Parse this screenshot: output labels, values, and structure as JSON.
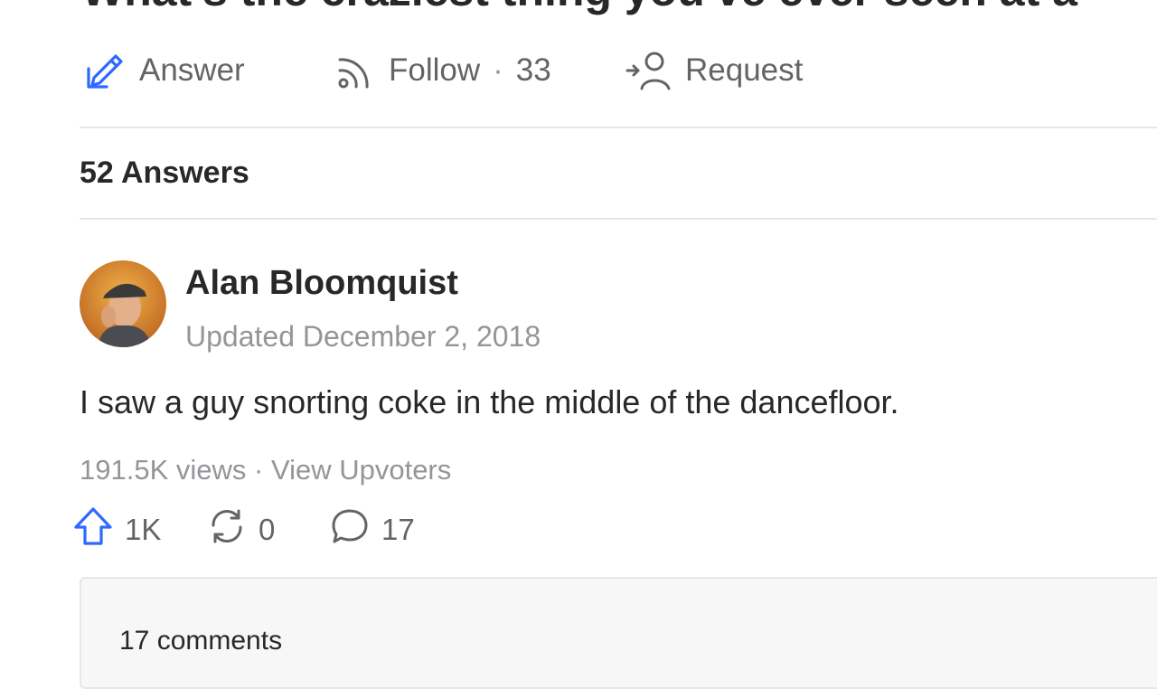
{
  "question": {
    "title": "What's the craziest thing you've ever seen at a"
  },
  "actions": {
    "answer_label": "Answer",
    "follow_label": "Follow",
    "follow_separator": "·",
    "follow_count": "33",
    "request_label": "Request"
  },
  "answers_header": {
    "count_label": "52 Answers"
  },
  "answer": {
    "author_name": "Alan Bloomquist",
    "timestamp": "Updated December 2, 2018",
    "text": "I saw a guy snorting coke in the middle of the dancefloor.",
    "views": "191.5K views",
    "meta_separator": "·",
    "view_upvoters_label": "View Upvoters",
    "upvotes": "1K",
    "shares": "0",
    "comments_count": "17"
  },
  "comments": {
    "label": "17 comments"
  },
  "icons": {
    "answer": "pencil-icon",
    "follow": "follow-signal-icon",
    "request": "request-user-icon",
    "upvote": "upvote-arrow-icon",
    "share": "share-cycle-icon",
    "comment": "comment-bubble-icon"
  },
  "colors": {
    "accent_blue": "#2e69ff",
    "text_primary": "#282829",
    "text_secondary": "#636466",
    "text_muted": "#939598",
    "divider": "#e6e7e8",
    "comments_bg": "#f7f7f8"
  }
}
